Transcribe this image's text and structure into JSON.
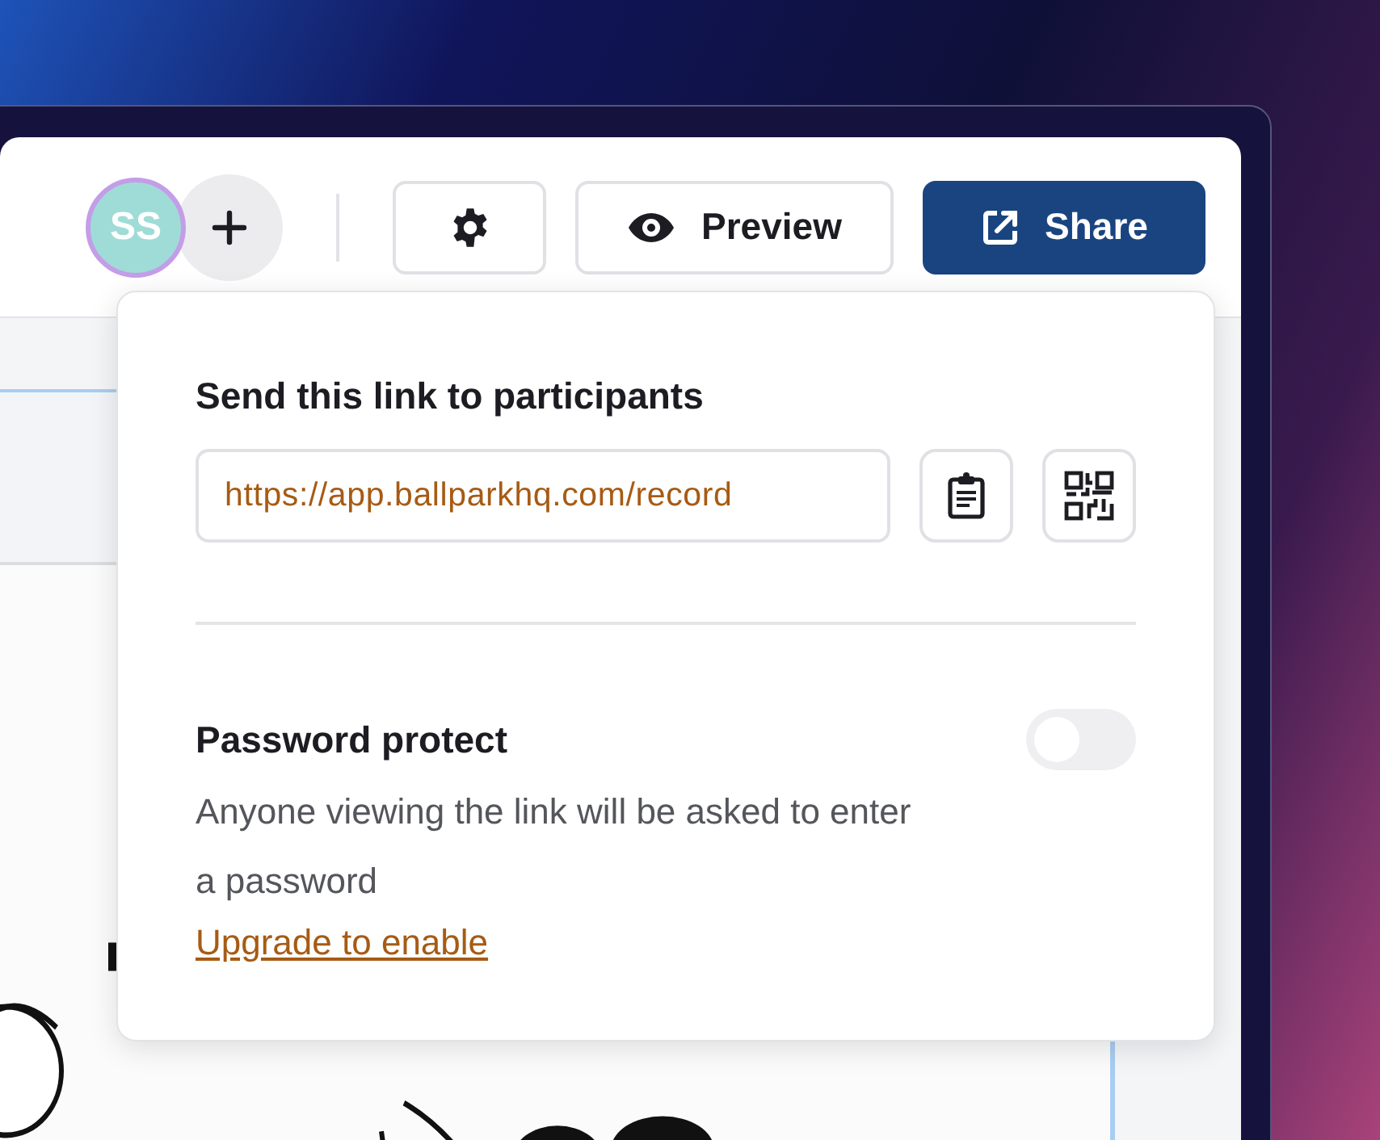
{
  "toolbar": {
    "avatar": {
      "initials": "SS"
    },
    "buttons": [
      {
        "kind": "add"
      },
      {
        "kind": "settings"
      },
      {
        "kind": "preview",
        "label": "Preview"
      },
      {
        "kind": "share",
        "label": "Share"
      }
    ]
  },
  "popup": {
    "title": "Send this link to participants",
    "link": "https://app.ballparkhq.com/record",
    "actions": [
      {
        "kind": "copy"
      },
      {
        "kind": "qr"
      }
    ],
    "password": {
      "title": "Password protect",
      "on": false,
      "description": "Anyone viewing the link will be asked to enter a password",
      "link": "Upgrade to enable"
    }
  }
}
